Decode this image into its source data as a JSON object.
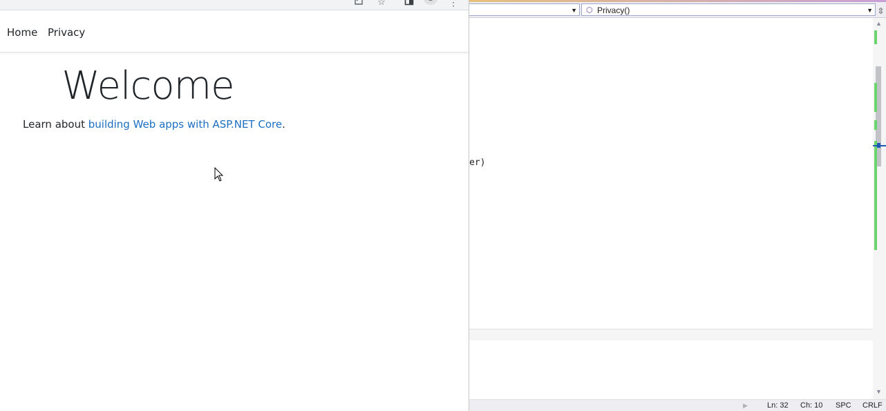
{
  "browser": {
    "toolbar_icons": [
      "share-icon",
      "star-icon",
      "side-panel-icon",
      "profile-icon",
      "menu-icon"
    ],
    "nav": {
      "home": "Home",
      "privacy": "Privacy"
    },
    "heading": "Welcome",
    "intro_text": "Learn about ",
    "intro_link": "building Web apps with ASP.NET Core",
    "intro_period": "."
  },
  "vs": {
    "member_combo": "Privacy()",
    "code_fragment": "er)",
    "status": {
      "ln": "Ln: 32",
      "ch": "Ch: 10",
      "spc": "SPC",
      "crlf": "CRLF"
    },
    "colors": {
      "change_margin": "#6cd46c",
      "link": "#1b6ec2"
    }
  }
}
